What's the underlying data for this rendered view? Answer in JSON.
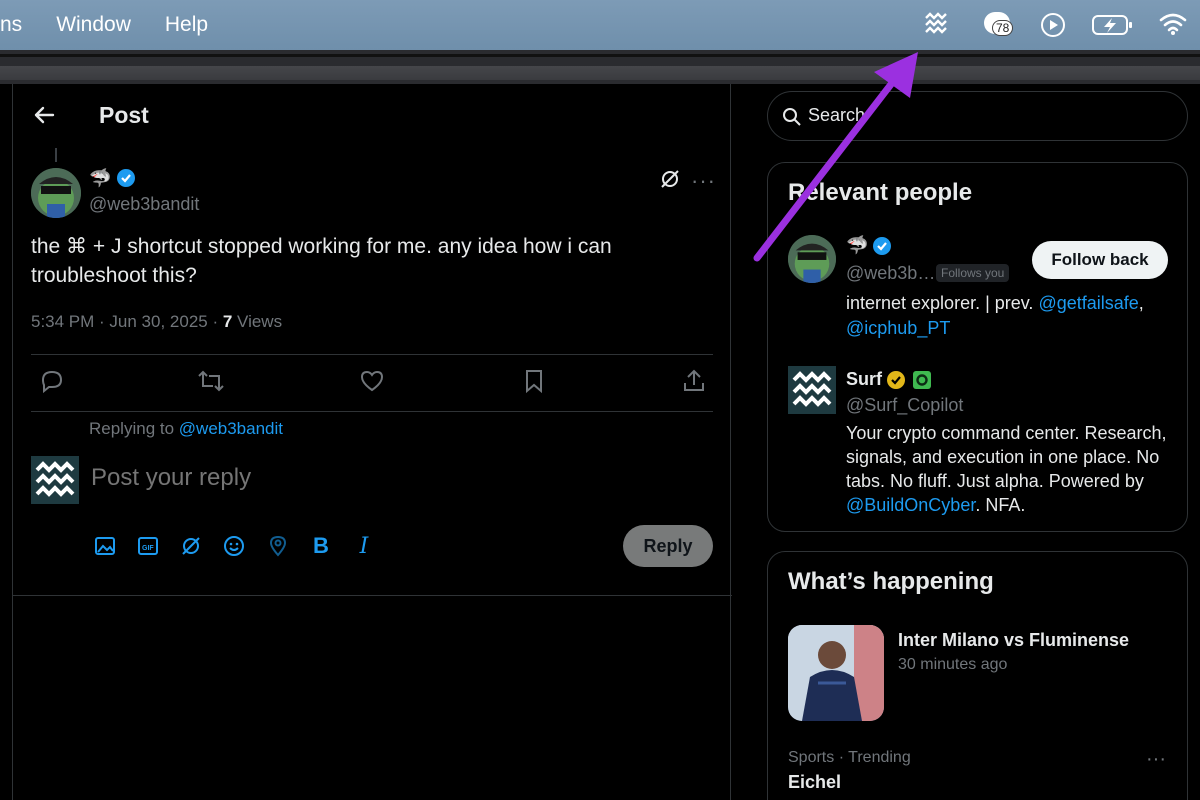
{
  "menubar": {
    "items": [
      "ns",
      "Window",
      "Help"
    ],
    "notification_count": "78",
    "icons": [
      "surf-icon",
      "cloud-badge-icon",
      "play-icon",
      "battery-icon",
      "wifi-icon"
    ]
  },
  "post": {
    "header_title": "Post",
    "author_emoji": "🦈",
    "author_handle": "@web3bandit",
    "text": "the ⌘ + J shortcut stopped working for me. any idea how i can troubleshoot this?",
    "time": "5:34 PM · Jun 30, 2025 · ",
    "views_count": "7",
    "views_label": " Views",
    "more": "···"
  },
  "reply": {
    "replying_prefix": "Replying to ",
    "replying_handle": "@web3bandit",
    "placeholder": "Post your reply",
    "button_label": "Reply"
  },
  "search": {
    "placeholder": "Search"
  },
  "relevant_people": {
    "title": "Relevant people",
    "person1": {
      "emoji": "🦈",
      "handle": "@web3b…",
      "follows_you": "Follows you",
      "follow_button": "Follow back",
      "bio_prefix": "internet explorer. | prev. ",
      "bio_link1": "@getfailsafe",
      "bio_sep": ",",
      "bio_link2": "@icphub_PT"
    },
    "person2": {
      "name": "Surf",
      "handle": "@Surf_Copilot",
      "bio_prefix": "Your crypto command center. Research, signals, and execution in one place. No tabs. No fluff. Just alpha. Powered by ",
      "bio_link": "@BuildOnCyber",
      "bio_suffix": ". NFA."
    }
  },
  "happening": {
    "title": "What’s happening",
    "trend1": {
      "title": "Inter Milano vs Fluminense",
      "time": "30 minutes ago"
    },
    "trend2": {
      "category": "Sports · Trending",
      "title": "Eichel",
      "more": "···"
    }
  },
  "colors": {
    "accent": "#1d9bf0",
    "annotation_arrow": "#9b30e0",
    "verified_gold": "#e2b719"
  }
}
